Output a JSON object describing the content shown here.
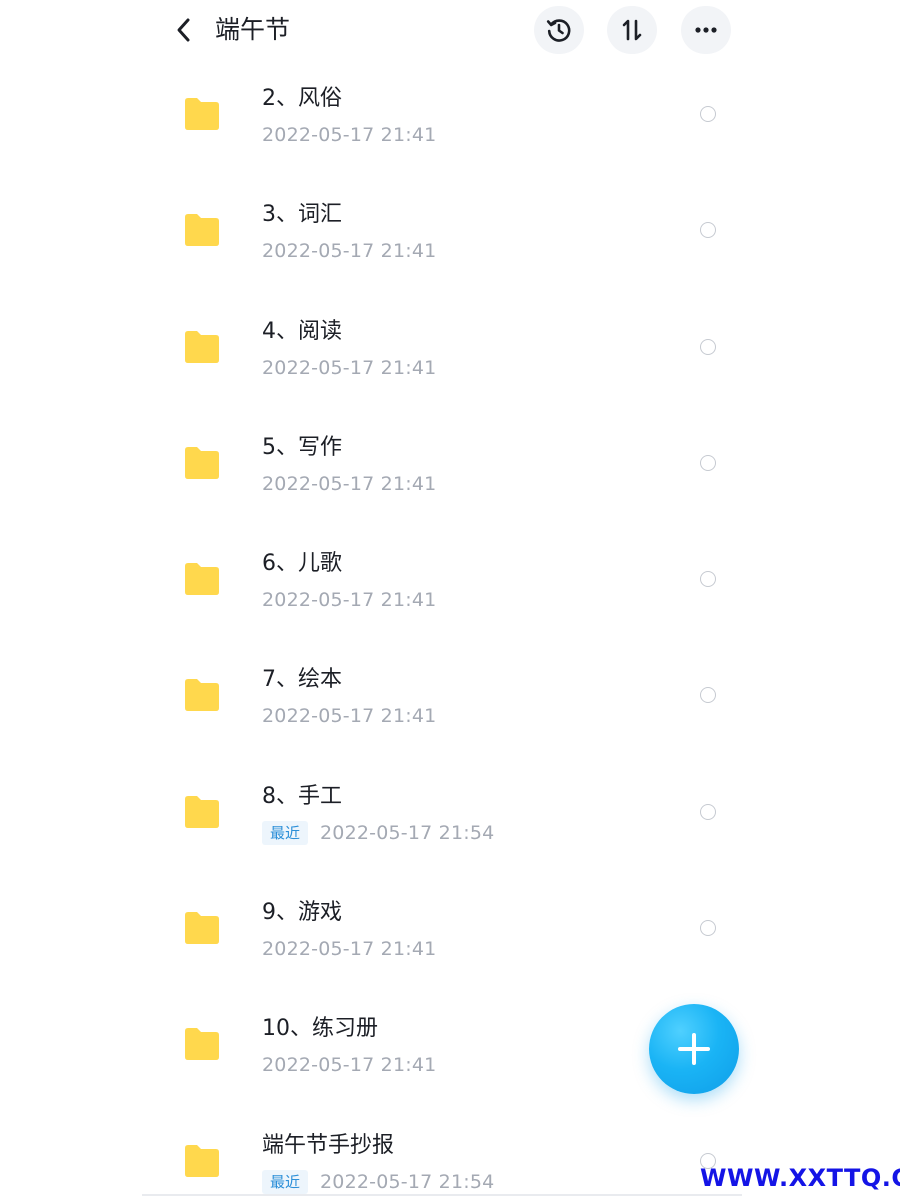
{
  "header": {
    "title": "端午节",
    "back_icon": "chevron-left-icon",
    "history_icon": "history-icon",
    "sort_icon": "sort-icon",
    "more_icon": "more-horizontal-icon"
  },
  "colors": {
    "folder": "#ffd84d",
    "fab": "#1ab4f5",
    "recent_badge_text": "#2c8fd8",
    "watermark": "#1414e6"
  },
  "files": [
    {
      "name": "2、风俗",
      "recent": "",
      "time": "2022-05-17  21:41"
    },
    {
      "name": "3、词汇",
      "recent": "",
      "time": "2022-05-17  21:41"
    },
    {
      "name": "4、阅读",
      "recent": "",
      "time": "2022-05-17  21:41"
    },
    {
      "name": "5、写作",
      "recent": "",
      "time": "2022-05-17  21:41"
    },
    {
      "name": "6、儿歌",
      "recent": "",
      "time": "2022-05-17  21:41"
    },
    {
      "name": "7、绘本",
      "recent": "",
      "time": "2022-05-17  21:41"
    },
    {
      "name": "8、手工",
      "recent": "最近",
      "time": "2022-05-17  21:54"
    },
    {
      "name": "9、游戏",
      "recent": "",
      "time": "2022-05-17  21:41"
    },
    {
      "name": "10、练习册",
      "recent": "",
      "time": "2022-05-17  21:41"
    },
    {
      "name": "端午节手抄报",
      "recent": "最近",
      "time": "2022-05-17  21:54"
    }
  ],
  "fab": {
    "icon": "plus-icon"
  },
  "watermark": "WWW.XXTTQ.COM"
}
